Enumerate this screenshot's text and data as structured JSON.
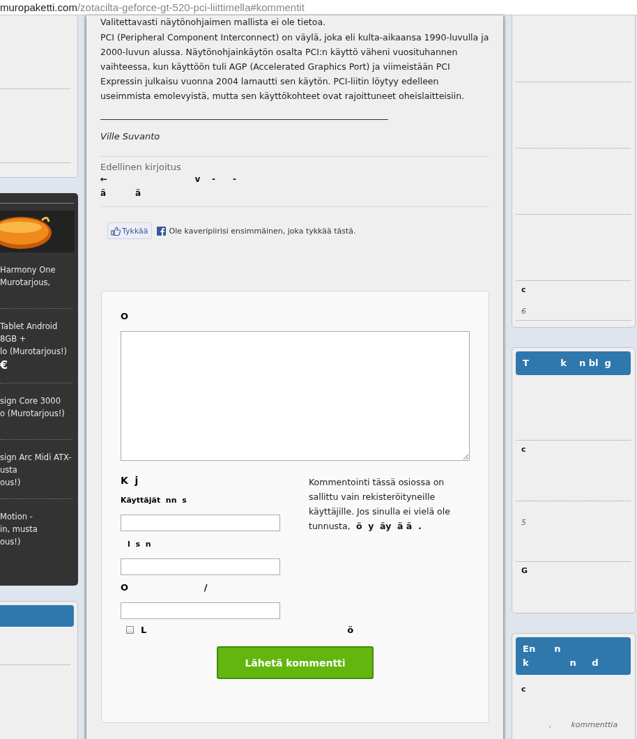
{
  "address_bar": {
    "domain": "muropaketti.com",
    "path": "/zotacilta-geforce-gt-520-pci-liittimella#kommentit"
  },
  "left_sidebar": {
    "top_card": {
      "sections": [
        {
          "kind": "blank"
        },
        {
          "kind": "blank"
        }
      ]
    },
    "offers_card": {
      "offers": [
        {
          "lines": [
            "Harmony One",
            "Murotarjous,"
          ]
        },
        {
          "lines": [
            "Tablet Android",
            "8GB +",
            "lo (Murotarjous!)"
          ],
          "price": "€"
        },
        {
          "lines": [
            "sign Core 3000",
            "o (Murotarjous!)"
          ]
        },
        {
          "lines": [
            "sign Arc Midi ATX-",
            "usta",
            "ous!)"
          ]
        },
        {
          "lines": [
            "Motion -",
            "in, musta",
            "ous!)"
          ]
        }
      ]
    },
    "bottom_card": {
      "sections": [
        {
          "kind": "blank"
        }
      ]
    }
  },
  "article": {
    "cut_line": "Valitettavasti näytönohjaimen mallista ei ole tietoa.",
    "paragraph": "PCI (Peripheral Component Interconnect) on väylä, joka eli kulta-aikaansa 1990-luvulla ja 2000-luvun alussa. Näytönohjainkäytön osalta PCI:n käyttö väheni vuosituhannen vaihteessa, kun käyttöön tuli AGP (Accelerated Graphics Port) ja viimeistään PCI Expressin julkaisu vuonna 2004 lamautti sen käytön. PCI-liitin löytyy edelleen useimmista emolevyistä, mutta sen käyttökohteet ovat rajoittuneet oheislaitteisiin.",
    "author": "Ville Suvanto",
    "previous_label": "Edellinen kirjoitus",
    "previous_link": [
      "←                              v    -      -",
      "ä          ä"
    ],
    "like_button": "Tykkää",
    "like_text": "Ole kaveripiirisi ensimmäinen, joka tykkää tästä."
  },
  "comment_form": {
    "heading": "O",
    "login_heading": "K  j",
    "username_label": "Käyttäjät  nn  s",
    "password_label": "l  s  n",
    "third_label": "O                        /",
    "remember": {
      "label": "L",
      "checked": false,
      "tail": "ö"
    },
    "note": [
      "Kommentointi tässä osiossa on sallittu vain rekisteröityneille käyttäjille. Jos sinulla ei vielä ole tunnusta,",
      " ö  y  äy  ä ä  ."
    ],
    "submit": "Lähetä kommentti"
  },
  "right_sidebar": {
    "cards": [
      {
        "sections": [
          {
            "kind": "blank"
          },
          {
            "kind": "blank"
          },
          {
            "kind": "blank"
          },
          {
            "kind": "blank"
          },
          {
            "kind": "entry",
            "title": "c",
            "meta": "6"
          }
        ]
      },
      {
        "header": [
          "T          k    n bl  g"
        ],
        "sections": [
          {
            "kind": "blank"
          },
          {
            "kind": "entry",
            "title": "c"
          },
          {
            "kind": "entry",
            "meta": "5"
          },
          {
            "kind": "entry",
            "title": "G"
          }
        ]
      },
      {
        "header": [
          "En      n",
          "k             n     d"
        ],
        "sections": [
          {
            "kind": "entry",
            "title": "c",
            "meta": ",        kommenttia"
          }
        ]
      }
    ]
  }
}
